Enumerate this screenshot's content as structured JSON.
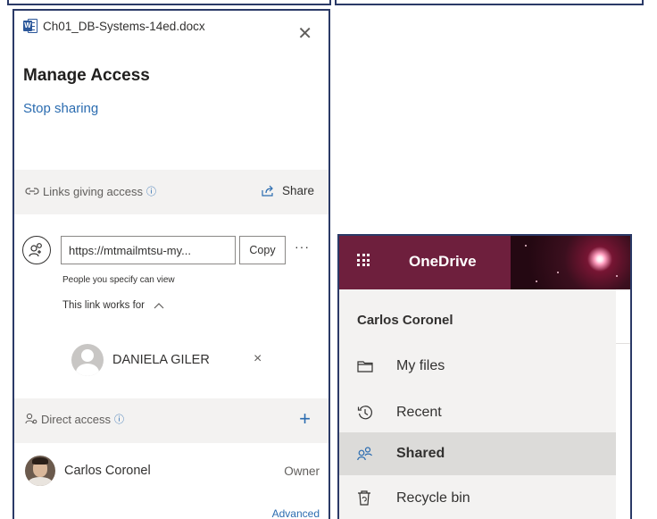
{
  "share_panel": {
    "file_name": "Ch01_DB-Systems-14ed.docx",
    "file_icon": "word-doc-icon",
    "close_icon": "close-icon",
    "title": "Manage Access",
    "stop_sharing": "Stop sharing",
    "links_section": {
      "label": "Links giving access",
      "info_icon": "info-icon",
      "share_label": "Share"
    },
    "link": {
      "url": "https://mtmailmtsu-my...",
      "copy_label": "Copy",
      "more_label": "···",
      "audience": "People you specify can view",
      "works_for_label": "This link works for",
      "person": "DANIELA GILER",
      "remove_label": "×"
    },
    "direct_section": {
      "label": "Direct access",
      "add_label": "+"
    },
    "owner": {
      "name": "Carlos Coronel",
      "role": "Owner"
    },
    "advanced_label": "Advanced"
  },
  "onedrive": {
    "app_title": "OneDrive",
    "brand_color": "#6e1f3d",
    "user_name": "Carlos Coronel",
    "nav": [
      {
        "label": "My files",
        "icon": "folder-icon",
        "selected": false
      },
      {
        "label": "Recent",
        "icon": "history-icon",
        "selected": false
      },
      {
        "label": "Shared",
        "icon": "people-icon",
        "selected": true
      },
      {
        "label": "Recycle bin",
        "icon": "recycle-bin-icon",
        "selected": false
      }
    ]
  }
}
